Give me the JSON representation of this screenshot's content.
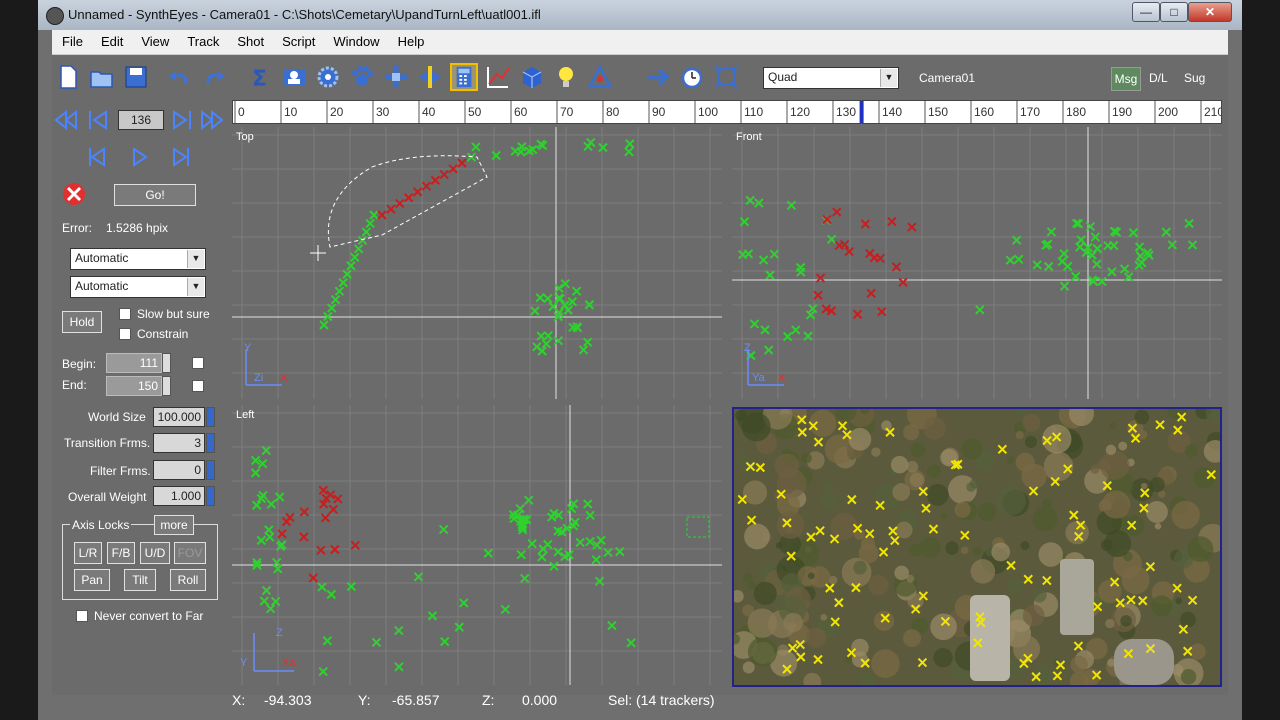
{
  "window": {
    "title": "Unnamed - SynthEyes - Camera01 - C:\\Shots\\Cemetary\\UpandTurnLeft\\uatl001.ifl",
    "buttons": {
      "minimize": "—",
      "maximize": "□",
      "close": "✕"
    }
  },
  "menu": [
    "File",
    "Edit",
    "View",
    "Track",
    "Shot",
    "Script",
    "Window",
    "Help"
  ],
  "toolbar": {
    "icons": [
      "new-file-icon",
      "open-folder-icon",
      "save-icon",
      "undo-icon",
      "redo-icon",
      "sigma-icon",
      "camera-card-icon",
      "gear-icon",
      "paw-icon",
      "move-icon",
      "balance-icon",
      "calculator-icon",
      "graph-icon",
      "cube-icon",
      "lightbulb-icon",
      "triangle-icon",
      "arrow-right-icon",
      "stopwatch-icon",
      "fit-icon"
    ],
    "active_icon": "calculator-icon",
    "layout_select": "Quad",
    "camera_label": "Camera01",
    "msg": "Msg",
    "dl": "D/L",
    "sug": "Sug"
  },
  "playback": {
    "frame": "136",
    "timeline_ticks": [
      "0",
      "10",
      "20",
      "30",
      "40",
      "50",
      "60",
      "70",
      "80",
      "90",
      "100",
      "110",
      "120",
      "130",
      "140",
      "150",
      "160",
      "170",
      "180",
      "190",
      "200",
      "210"
    ],
    "current_frame": 136
  },
  "solver": {
    "go_label": "Go!",
    "error_label": "Error:",
    "error_value": "1.5286 hpix",
    "mode1": "Automatic",
    "mode2": "Automatic",
    "hold_label": "Hold",
    "slow_label": "Slow but sure",
    "constrain_label": "Constrain",
    "begin_label": "Begin:",
    "begin_value": "111",
    "end_label": "End:",
    "end_value": "150",
    "world_size_label": "World Size",
    "world_size_value": "100.000",
    "transition_label": "Transition Frms.",
    "transition_value": "3",
    "filter_label": "Filter Frms.",
    "filter_value": "0",
    "weight_label": "Overall Weight",
    "weight_value": "1.000",
    "axis_locks_label": "Axis Locks",
    "more_label": "more",
    "locks": [
      "L/R",
      "F/B",
      "U/D",
      "FOV"
    ],
    "rot_locks": [
      "Pan",
      "Tilt",
      "Roll"
    ],
    "never_far_label": "Never convert to Far"
  },
  "viewports": {
    "top": "Top",
    "front": "Front",
    "left": "Left",
    "axes_top": [
      "Y",
      "Zi",
      "X"
    ],
    "axes_front": [
      "Z",
      "Ya",
      "X"
    ],
    "axes_left": [
      "Z",
      "Y",
      "Xa"
    ]
  },
  "status": {
    "x_label": "X:",
    "x_value": "-94.303",
    "y_label": "Y:",
    "y_value": "-65.857",
    "z_label": "Z:",
    "z_value": "0.000",
    "sel": "Sel: (14 trackers)"
  },
  "colors": {
    "tracker": "#2fd12f",
    "selected": "#c81e1e",
    "camera_tracker": "#f2e600",
    "accent": "#f0c000"
  }
}
